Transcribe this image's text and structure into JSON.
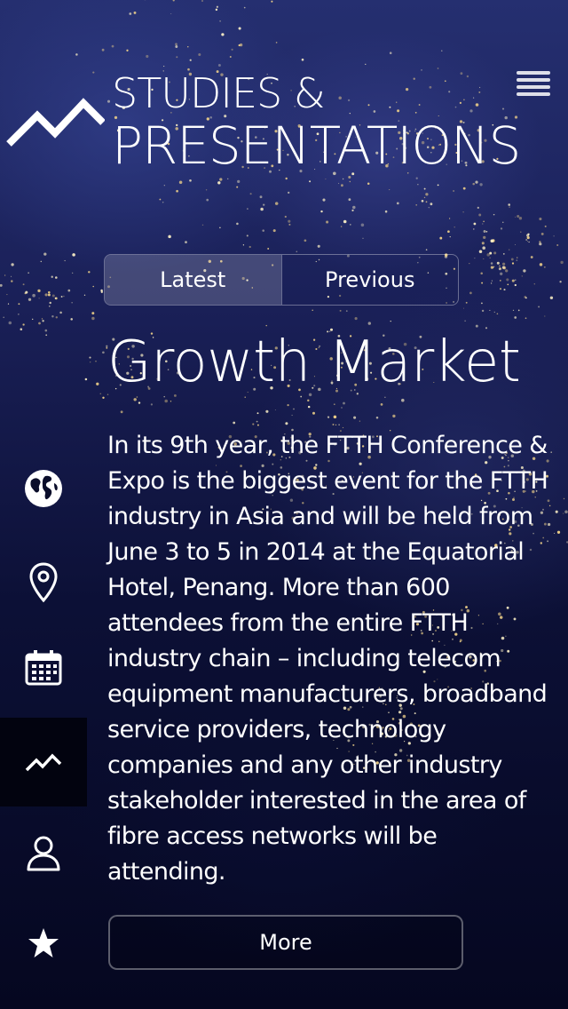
{
  "header": {
    "title_line1": "STUDIES &",
    "title_line2": "PRESENTATIONS",
    "logo_icon": "growth-chart-logo",
    "menu_icon": "hamburger-menu-icon"
  },
  "tabs": [
    {
      "label": "Latest",
      "active": true
    },
    {
      "label": "Previous",
      "active": false
    }
  ],
  "article": {
    "headline": "Growth Market",
    "body": "In its 9th year, the FTTH Conference & Expo is the biggest event for the FTTH industry in Asia and will be held from June 3 to 5 in 2014 at the Equatorial Hotel, Penang. More than 600 attendees from the entire FTTH industry chain – including telecom equipment manufacturers, broadband service providers, technology companies and any other industry stakeholder interested in the area of fibre access networks will be attending.",
    "more_label": "More"
  },
  "sidebar": {
    "items": [
      {
        "icon": "globe-icon",
        "active": false
      },
      {
        "icon": "location-pin-icon",
        "active": false
      },
      {
        "icon": "calendar-icon",
        "active": false
      },
      {
        "icon": "growth-chart-icon",
        "active": true
      },
      {
        "icon": "person-icon",
        "active": false
      },
      {
        "icon": "star-icon",
        "active": false
      }
    ]
  },
  "colors": {
    "background": "#05081f",
    "active_nav": "#02030f",
    "text": "#ffffff"
  }
}
